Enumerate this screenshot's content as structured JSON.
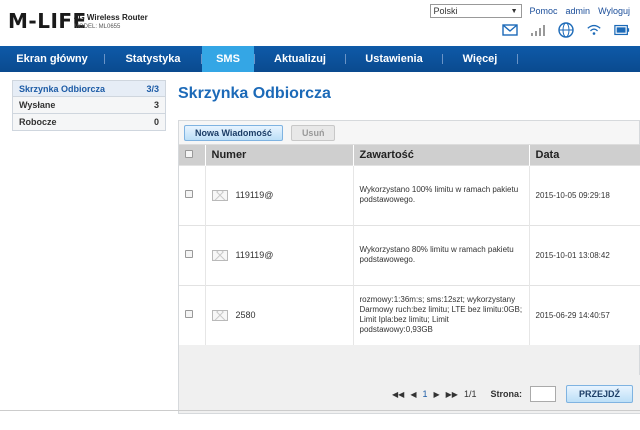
{
  "header": {
    "logo_text": "M-LIFE",
    "product_title": "4G Wireless Router",
    "product_model": "MODEL: ML0655",
    "language": "Polski",
    "help_link": "Pomoc",
    "user_link": "admin",
    "logout_link": "Wyloguj"
  },
  "nav": {
    "items": [
      "Ekran główny",
      "Statystyka",
      "SMS",
      "Aktualizuj",
      "Ustawienia",
      "Więcej"
    ],
    "active_index": 2
  },
  "sidebar": {
    "items": [
      {
        "label": "Skrzynka Odbiorcza",
        "count": "3/3"
      },
      {
        "label": "Wysłane",
        "count": "3"
      },
      {
        "label": "Robocze",
        "count": "0"
      }
    ]
  },
  "main": {
    "title": "Skrzynka Odbiorcza",
    "new_message_label": "Nowa Wiadomość",
    "delete_label": "Usuń",
    "columns": [
      "Numer",
      "Zawartość",
      "Data"
    ],
    "messages": [
      {
        "number": "119119@",
        "content": "Wykorzystano 100% limitu w ramach pakietu podstawowego.",
        "date": "2015-10-05 09:29:18"
      },
      {
        "number": "119119@",
        "content": "Wykorzystano 80% limitu w ramach pakietu podstawowego.",
        "date": "2015-10-01 13:08:42"
      },
      {
        "number": "2580",
        "content": "rozmowy:1:36m:s; sms:12szt; wykorzystany Darmowy ruch:bez limitu; LTE bez limitu:0GB; Limit Ipla:bez limitu; Limit podstawowy:0,93GB",
        "date": "2015-06-29 14:40:57"
      }
    ],
    "pager": {
      "current_page": "1",
      "page_info": "1/1",
      "page_label": "Strona:",
      "go_label": "PRZEJDŹ"
    }
  },
  "colors": {
    "nav_bg": "#0a4a8f",
    "nav_active": "#34a6e5",
    "title": "#1c6ab8"
  }
}
